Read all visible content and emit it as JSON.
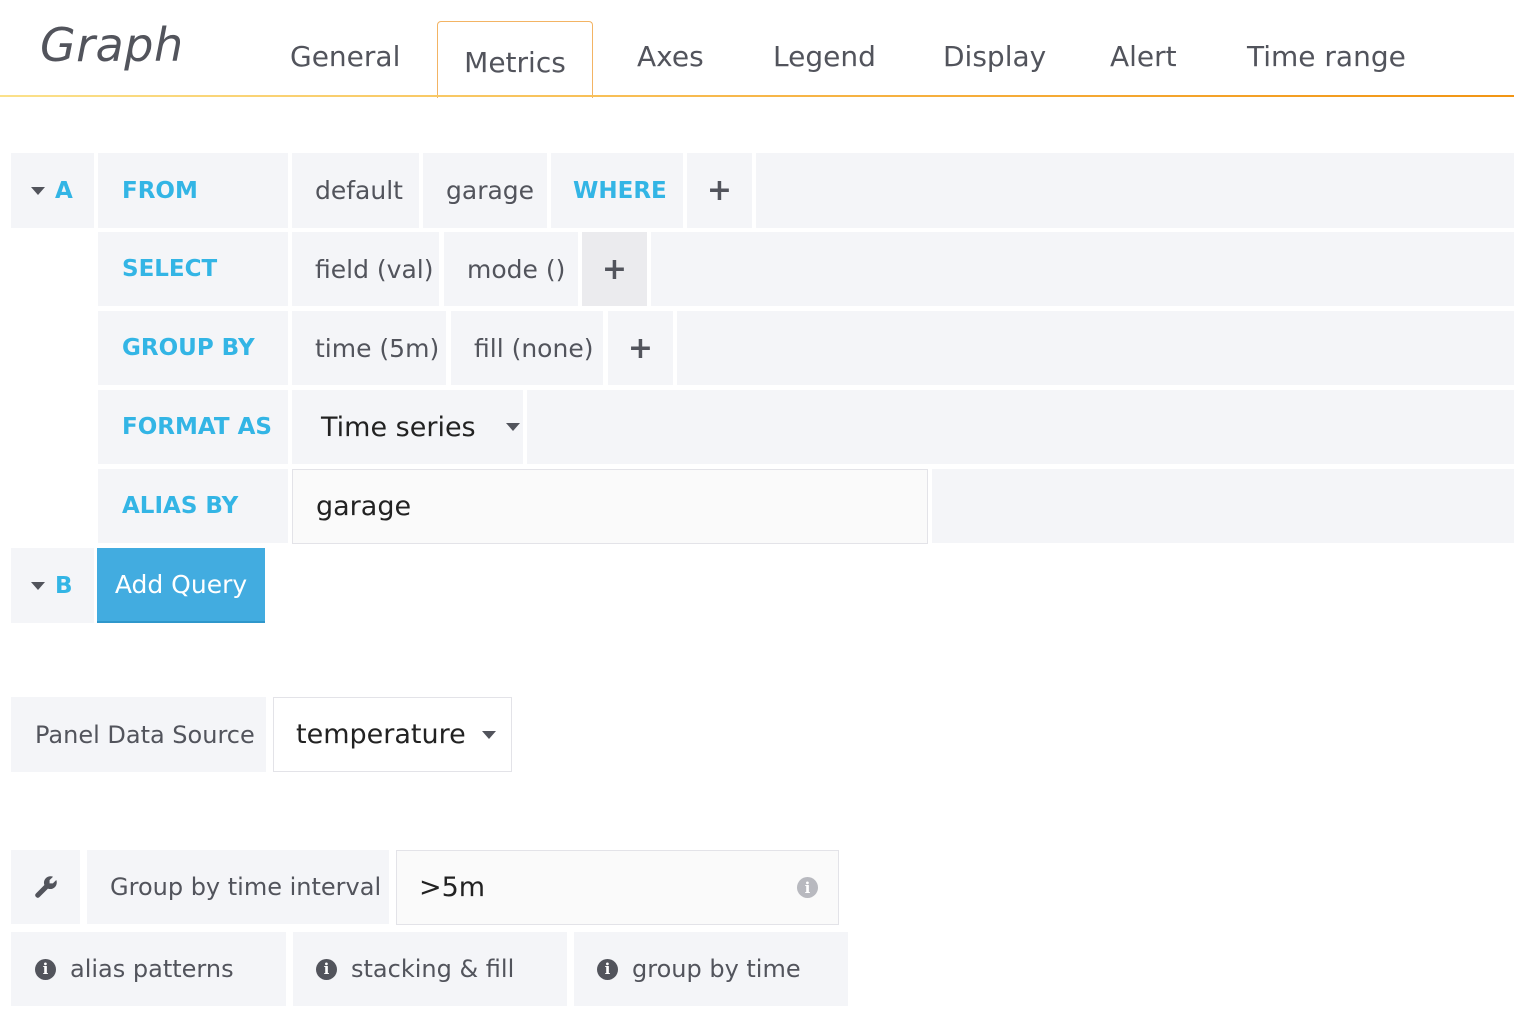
{
  "header": {
    "title": "Graph",
    "tabs": [
      "General",
      "Metrics",
      "Axes",
      "Legend",
      "Display",
      "Alert",
      "Time range"
    ],
    "active_tab": "Metrics"
  },
  "queries": {
    "a": {
      "ref": "A",
      "from_kw": "FROM",
      "policy": "default",
      "measurement": "garage",
      "where_kw": "WHERE",
      "select_kw": "SELECT",
      "field": "field (val)",
      "func": "mode ()",
      "group_kw": "GROUP BY",
      "group_time": "time (5m)",
      "group_fill": "fill (none)",
      "format_kw": "FORMAT AS",
      "format_value": "Time series",
      "alias_kw": "ALIAS BY",
      "alias_value": "garage",
      "plus": "+"
    },
    "b": {
      "ref": "B",
      "add_label": "Add Query"
    }
  },
  "datasource": {
    "label": "Panel Data Source",
    "value": "temperature"
  },
  "options": {
    "interval_label": "Group by time interval",
    "interval_value": ">5m",
    "help": [
      "alias patterns",
      "stacking & fill",
      "group by time"
    ]
  },
  "icons": {
    "wrench": "wrench-icon",
    "info": "info-icon",
    "caret": "caret-down-icon"
  },
  "colors": {
    "keyword": "#33b5e5",
    "button": "#42ace0",
    "tab_border": "#f3b464"
  }
}
